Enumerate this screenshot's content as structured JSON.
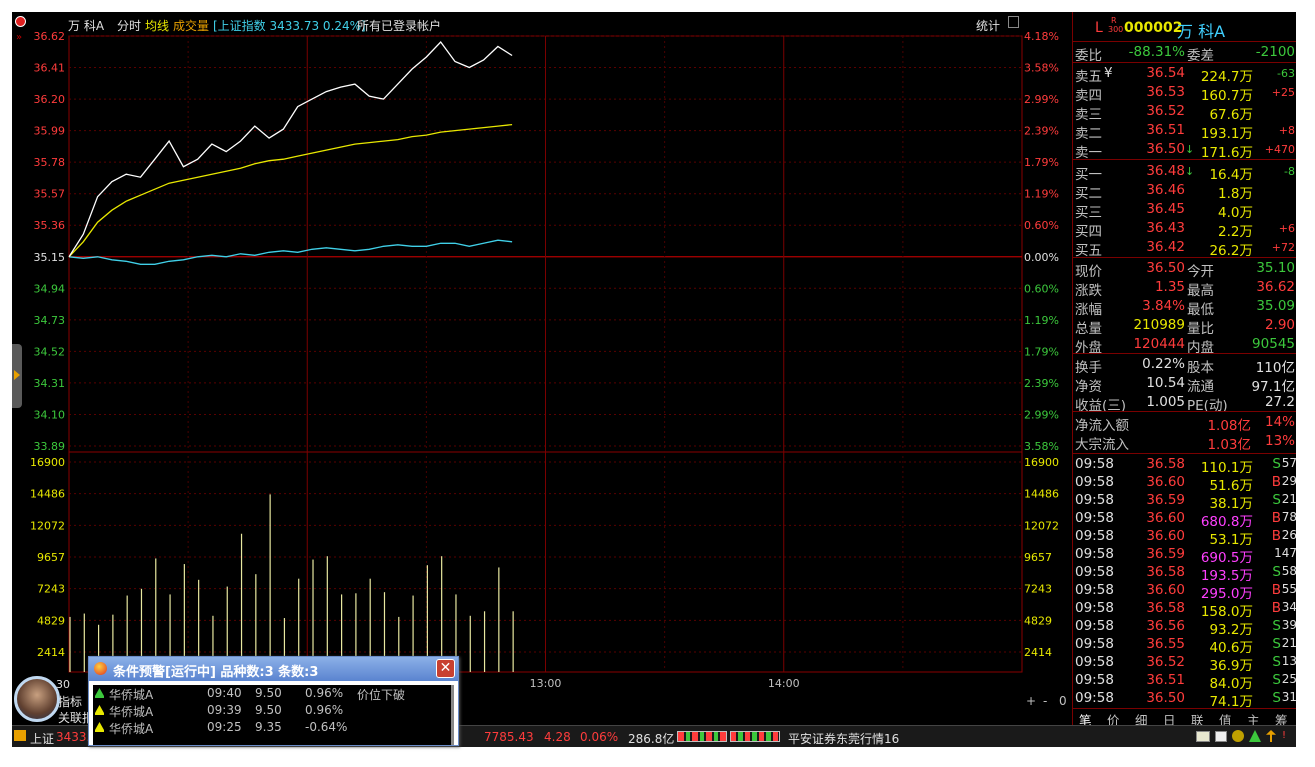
{
  "header": {
    "stock_name": "万 科A",
    "view_mode": "分时",
    "avg_line_label": "均线",
    "volume_label": "成交量",
    "index_info": "[上证指数 3433.73 0.24%]",
    "account_label": "所有已登录帐户",
    "stats_label": "统计"
  },
  "chart_data": {
    "type": "line",
    "title": "",
    "price_ticks": [
      "36.62",
      "36.41",
      "36.20",
      "35.99",
      "35.78",
      "35.57",
      "35.36",
      "35.15",
      "34.94",
      "34.73",
      "34.52",
      "34.31",
      "34.10",
      "33.89"
    ],
    "pct_ticks": [
      "4.18%",
      "3.58%",
      "2.99%",
      "2.39%",
      "1.79%",
      "1.19%",
      "0.60%",
      "0.00%",
      "0.60%",
      "1.19%",
      "1.79%",
      "2.39%",
      "2.99%",
      "3.58%"
    ],
    "volume_ticks": [
      "16900",
      "14486",
      "12072",
      "9657",
      "7243",
      "4829",
      "2414"
    ],
    "time_labels": [
      "13:00",
      "14:00"
    ],
    "prev_close": 35.15,
    "ylim": [
      33.89,
      36.62
    ],
    "series": [
      {
        "name": "价格",
        "color": "#ffffff",
        "values": [
          35.15,
          35.3,
          35.55,
          35.65,
          35.7,
          35.68,
          35.8,
          35.92,
          35.75,
          35.8,
          35.9,
          35.85,
          35.92,
          36.02,
          35.94,
          36.0,
          36.15,
          36.2,
          36.25,
          36.28,
          36.3,
          36.22,
          36.2,
          36.3,
          36.4,
          36.48,
          36.58,
          36.45,
          36.41,
          36.46,
          36.55,
          36.49
        ]
      },
      {
        "name": "均价",
        "color": "#e8e800",
        "values": [
          35.15,
          35.25,
          35.38,
          35.46,
          35.52,
          35.56,
          35.6,
          35.64,
          35.66,
          35.68,
          35.7,
          35.72,
          35.74,
          35.77,
          35.79,
          35.8,
          35.82,
          35.84,
          35.86,
          35.88,
          35.9,
          35.91,
          35.92,
          35.93,
          35.95,
          35.96,
          35.98,
          35.99,
          36.0,
          36.01,
          36.02,
          36.03
        ]
      },
      {
        "name": "指数",
        "color": "#40d0e8",
        "values": [
          35.15,
          35.14,
          35.15,
          35.13,
          35.12,
          35.1,
          35.1,
          35.12,
          35.13,
          35.15,
          35.16,
          35.15,
          35.17,
          35.16,
          35.18,
          35.19,
          35.18,
          35.2,
          35.21,
          35.2,
          35.19,
          35.2,
          35.22,
          35.23,
          35.22,
          35.22,
          35.24,
          35.24,
          35.22,
          35.24,
          35.26,
          35.25
        ]
      }
    ],
    "volumes": [
      4900,
      5200,
      4200,
      5100,
      6800,
      7400,
      10100,
      6900,
      9600,
      8200,
      5000,
      7600,
      12300,
      8700,
      15800,
      4800,
      8300,
      10000,
      10300,
      6900,
      7000,
      8300,
      7100,
      4900,
      6800,
      9500,
      10300,
      6900,
      5000,
      5400,
      9300,
      5400
    ]
  },
  "quote": {
    "code": "000002",
    "name": "万 科A",
    "flag_l": "L",
    "flag_r": "R",
    "flag_300": "300",
    "wei_bi_label": "委比",
    "wei_bi": "-88.31%",
    "wei_cha_label": "委差",
    "wei_cha": "-2100",
    "asks": [
      {
        "label": "卖五",
        "price": "36.54",
        "vol": "224.7万",
        "chg": "-63"
      },
      {
        "label": "卖四",
        "price": "36.53",
        "vol": "160.7万",
        "chg": "+25"
      },
      {
        "label": "卖三",
        "price": "36.52",
        "vol": "67.6万",
        "chg": ""
      },
      {
        "label": "卖二",
        "price": "36.51",
        "vol": "193.1万",
        "chg": "+8"
      },
      {
        "label": "卖一",
        "price": "36.50",
        "vol": "171.6万",
        "chg": "+470"
      }
    ],
    "yen_mark": "¥",
    "bids": [
      {
        "label": "买一",
        "price": "36.48",
        "vol": "16.4万",
        "chg": "-8"
      },
      {
        "label": "买二",
        "price": "36.46",
        "vol": "1.8万",
        "chg": ""
      },
      {
        "label": "买三",
        "price": "36.45",
        "vol": "4.0万",
        "chg": ""
      },
      {
        "label": "买四",
        "price": "36.43",
        "vol": "2.2万",
        "chg": "+6"
      },
      {
        "label": "买五",
        "price": "36.42",
        "vol": "26.2万",
        "chg": "+72"
      }
    ],
    "stats": [
      {
        "l1": "现价",
        "v1": "36.50",
        "c1": "red",
        "l2": "今开",
        "v2": "35.10",
        "c2": "green"
      },
      {
        "l1": "涨跌",
        "v1": "1.35",
        "c1": "red",
        "l2": "最高",
        "v2": "36.62",
        "c2": "red"
      },
      {
        "l1": "涨幅",
        "v1": "3.84%",
        "c1": "red",
        "l2": "最低",
        "v2": "35.09",
        "c2": "green"
      },
      {
        "l1": "总量",
        "v1": "210989",
        "c1": "yellow",
        "l2": "量比",
        "v2": "2.90",
        "c2": "red"
      },
      {
        "l1": "外盘",
        "v1": "120444",
        "c1": "red",
        "l2": "内盘",
        "v2": "90545",
        "c2": "green"
      }
    ],
    "stats2": [
      {
        "l1": "换手",
        "v1": "0.22%",
        "l2": "股本",
        "v2": "110亿"
      },
      {
        "l1": "净资",
        "v1": "10.54",
        "l2": "流通",
        "v2": "97.1亿"
      },
      {
        "l1": "收益(三)",
        "v1": "1.005",
        "l2": "PE(动)",
        "v2": "27.2"
      }
    ],
    "flow": [
      {
        "label": "净流入额",
        "v": "1.08亿",
        "p": "14%"
      },
      {
        "label": "大宗流入",
        "v": "1.03亿",
        "p": "13%"
      }
    ]
  },
  "ticks": [
    {
      "t": "09:58",
      "p": "36.58",
      "v": "110.1万",
      "s": "S",
      "n": "57",
      "vc": "yellow"
    },
    {
      "t": "09:58",
      "p": "36.60",
      "v": "51.6万",
      "s": "B",
      "n": "29",
      "vc": "yellow"
    },
    {
      "t": "09:58",
      "p": "36.59",
      "v": "38.1万",
      "s": "S",
      "n": "21",
      "vc": "yellow"
    },
    {
      "t": "09:58",
      "p": "36.60",
      "v": "680.8万",
      "s": "B",
      "n": "78",
      "vc": "magenta"
    },
    {
      "t": "09:58",
      "p": "36.60",
      "v": "53.1万",
      "s": "B",
      "n": "26",
      "vc": "yellow"
    },
    {
      "t": "09:58",
      "p": "36.59",
      "v": "690.5万",
      "s": "",
      "n": "147",
      "vc": "magenta"
    },
    {
      "t": "09:58",
      "p": "36.58",
      "v": "193.5万",
      "s": "S",
      "n": "58",
      "vc": "magenta"
    },
    {
      "t": "09:58",
      "p": "36.60",
      "v": "295.0万",
      "s": "B",
      "n": "55",
      "vc": "magenta"
    },
    {
      "t": "09:58",
      "p": "36.58",
      "v": "158.0万",
      "s": "B",
      "n": "34",
      "vc": "yellow"
    },
    {
      "t": "09:58",
      "p": "36.56",
      "v": "93.2万",
      "s": "S",
      "n": "39",
      "vc": "yellow"
    },
    {
      "t": "09:58",
      "p": "36.55",
      "v": "40.6万",
      "s": "S",
      "n": "21",
      "vc": "yellow"
    },
    {
      "t": "09:58",
      "p": "36.52",
      "v": "36.9万",
      "s": "S",
      "n": "13",
      "vc": "yellow"
    },
    {
      "t": "09:58",
      "p": "36.51",
      "v": "84.0万",
      "s": "S",
      "n": "25",
      "vc": "yellow"
    },
    {
      "t": "09:58",
      "p": "36.50",
      "v": "74.1万",
      "s": "S",
      "n": "31",
      "vc": "yellow"
    }
  ],
  "right_tabs": [
    "笔",
    "价",
    "细",
    "日",
    "联",
    "值",
    "主",
    "筹"
  ],
  "popup": {
    "title": "条件预警[运行中] 品种数:3 条数:3",
    "rows": [
      {
        "name": "华侨城A",
        "time": "09:40",
        "price": "9.50",
        "pct": "0.96%",
        "note": "价位下破"
      },
      {
        "name": "华侨城A",
        "time": "09:39",
        "price": "9.50",
        "pct": "0.96%",
        "note": ""
      },
      {
        "name": "华侨城A",
        "time": "09:25",
        "price": "9.35",
        "pct": "-0.64%",
        "note": ""
      }
    ]
  },
  "bottom": {
    "sh_label": "上证",
    "sh_value": "3433.73",
    "idx2": "7785.43",
    "idx2_chg": "4.28",
    "idx2_pct": "0.06%",
    "amount": "286.8亿",
    "broker": "平安证券东莞行情16",
    "left_tab1": "指标",
    "left_tab2": "关联报",
    "zoom_plus": "+",
    "zoom_minus": "-",
    "zoom_zero": "0",
    "time_start": "30"
  }
}
